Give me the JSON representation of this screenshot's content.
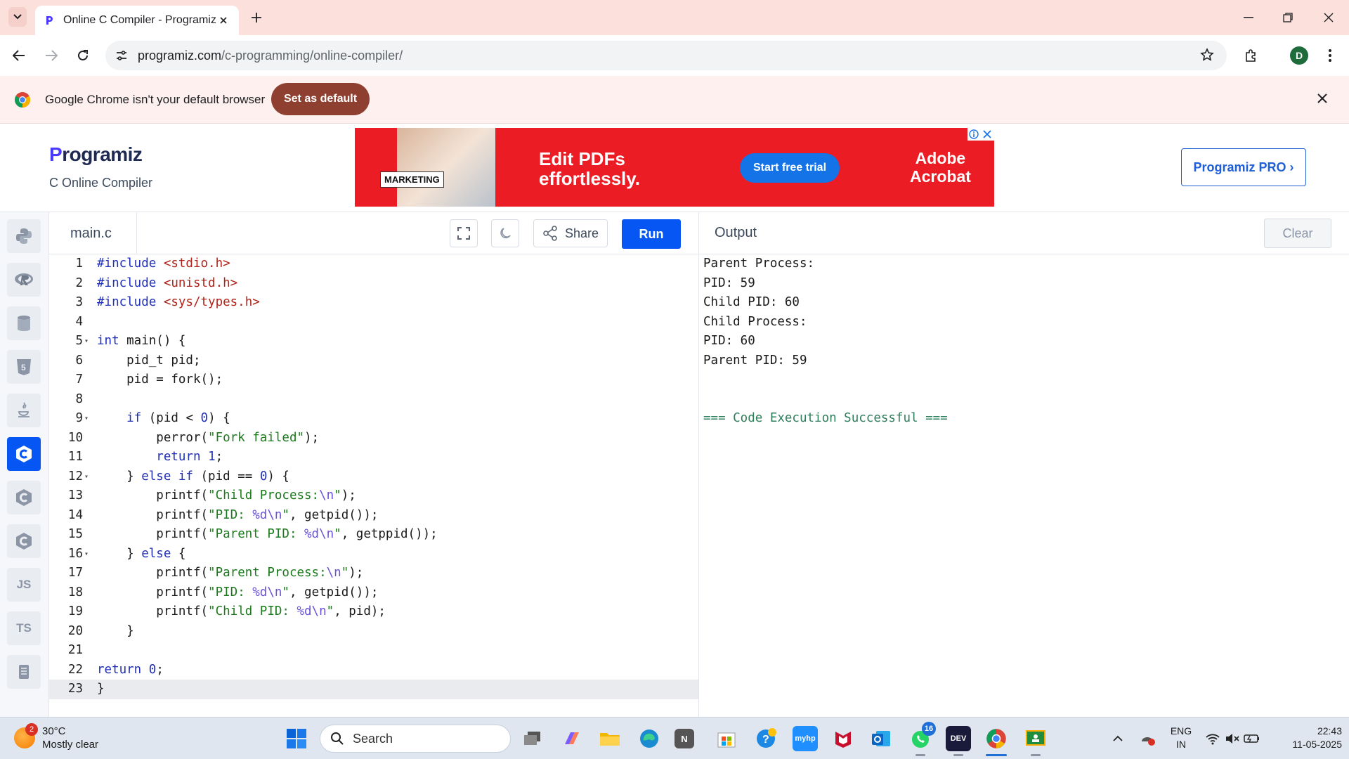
{
  "browser": {
    "tab_title": "Online C Compiler - Programiz",
    "url_host": "programiz.com",
    "url_path": "/c-programming/online-compiler/",
    "profile_initial": "D"
  },
  "infobar": {
    "message": "Google Chrome isn't your default browser",
    "button_label": "Set as default"
  },
  "site": {
    "logo_first": "P",
    "logo_rest": "rogramiz",
    "subtitle": "C Online Compiler",
    "pro_label": "Programiz PRO ›"
  },
  "ad": {
    "badge": "MARKETING",
    "headline_line1": "Edit PDFs",
    "headline_line2": "effortlessly.",
    "cta": "Start free trial",
    "brand_line1": "Adobe",
    "brand_line2": "Acrobat"
  },
  "sidebar": {
    "languages": [
      {
        "name": "python",
        "glyph": "",
        "active": false
      },
      {
        "name": "r",
        "glyph": "R",
        "active": false
      },
      {
        "name": "sql",
        "glyph": "",
        "active": false
      },
      {
        "name": "html",
        "glyph": "5",
        "active": false
      },
      {
        "name": "java",
        "glyph": "",
        "active": false
      },
      {
        "name": "c",
        "glyph": "C",
        "active": true
      },
      {
        "name": "cpp",
        "glyph": "C",
        "active": false
      },
      {
        "name": "csharp",
        "glyph": "C",
        "active": false
      },
      {
        "name": "javascript",
        "glyph": "JS",
        "active": false
      },
      {
        "name": "typescript",
        "glyph": "TS",
        "active": false
      },
      {
        "name": "go",
        "glyph": "",
        "active": false
      }
    ]
  },
  "editor": {
    "file_name": "main.c",
    "share_label": "Share",
    "run_label": "Run",
    "current_line": 23,
    "lines": [
      {
        "n": "1",
        "fold": false,
        "tokens": [
          {
            "t": "#include ",
            "c": "kw"
          },
          {
            "t": "<stdio.h>",
            "c": "inc"
          }
        ]
      },
      {
        "n": "2",
        "fold": false,
        "tokens": [
          {
            "t": "#include ",
            "c": "kw"
          },
          {
            "t": "<unistd.h>",
            "c": "inc"
          }
        ]
      },
      {
        "n": "3",
        "fold": false,
        "tokens": [
          {
            "t": "#include ",
            "c": "kw"
          },
          {
            "t": "<sys/types.h>",
            "c": "inc"
          }
        ]
      },
      {
        "n": "4",
        "fold": false,
        "tokens": []
      },
      {
        "n": "5",
        "fold": true,
        "tokens": [
          {
            "t": "int",
            "c": "kw"
          },
          {
            "t": " main() {",
            "c": ""
          }
        ]
      },
      {
        "n": "6",
        "fold": false,
        "tokens": [
          {
            "t": "    pid_t pid;",
            "c": ""
          }
        ]
      },
      {
        "n": "7",
        "fold": false,
        "tokens": [
          {
            "t": "    pid = fork();",
            "c": ""
          }
        ]
      },
      {
        "n": "8",
        "fold": false,
        "tokens": []
      },
      {
        "n": "9",
        "fold": true,
        "tokens": [
          {
            "t": "    ",
            "c": ""
          },
          {
            "t": "if",
            "c": "kw"
          },
          {
            "t": " (pid < ",
            "c": ""
          },
          {
            "t": "0",
            "c": "num"
          },
          {
            "t": ") {",
            "c": ""
          }
        ]
      },
      {
        "n": "10",
        "fold": false,
        "tokens": [
          {
            "t": "        perror(",
            "c": ""
          },
          {
            "t": "\"Fork failed\"",
            "c": "str"
          },
          {
            "t": ");",
            "c": ""
          }
        ]
      },
      {
        "n": "11",
        "fold": false,
        "tokens": [
          {
            "t": "        ",
            "c": ""
          },
          {
            "t": "return",
            "c": "kw"
          },
          {
            "t": " ",
            "c": ""
          },
          {
            "t": "1",
            "c": "num"
          },
          {
            "t": ";",
            "c": ""
          }
        ]
      },
      {
        "n": "12",
        "fold": true,
        "tokens": [
          {
            "t": "    } ",
            "c": ""
          },
          {
            "t": "else if",
            "c": "kw"
          },
          {
            "t": " (pid == ",
            "c": ""
          },
          {
            "t": "0",
            "c": "num"
          },
          {
            "t": ") {",
            "c": ""
          }
        ]
      },
      {
        "n": "13",
        "fold": false,
        "tokens": [
          {
            "t": "        printf(",
            "c": ""
          },
          {
            "t": "\"Child Process:",
            "c": "str"
          },
          {
            "t": "\\n",
            "c": "esc"
          },
          {
            "t": "\"",
            "c": "str"
          },
          {
            "t": ");",
            "c": ""
          }
        ]
      },
      {
        "n": "14",
        "fold": false,
        "tokens": [
          {
            "t": "        printf(",
            "c": ""
          },
          {
            "t": "\"PID: ",
            "c": "str"
          },
          {
            "t": "%d\\n",
            "c": "esc"
          },
          {
            "t": "\"",
            "c": "str"
          },
          {
            "t": ", getpid());",
            "c": ""
          }
        ]
      },
      {
        "n": "15",
        "fold": false,
        "tokens": [
          {
            "t": "        printf(",
            "c": ""
          },
          {
            "t": "\"Parent PID: ",
            "c": "str"
          },
          {
            "t": "%d\\n",
            "c": "esc"
          },
          {
            "t": "\"",
            "c": "str"
          },
          {
            "t": ", getppid());",
            "c": ""
          }
        ]
      },
      {
        "n": "16",
        "fold": true,
        "tokens": [
          {
            "t": "    } ",
            "c": ""
          },
          {
            "t": "else",
            "c": "kw"
          },
          {
            "t": " {",
            "c": ""
          }
        ]
      },
      {
        "n": "17",
        "fold": false,
        "tokens": [
          {
            "t": "        printf(",
            "c": ""
          },
          {
            "t": "\"Parent Process:",
            "c": "str"
          },
          {
            "t": "\\n",
            "c": "esc"
          },
          {
            "t": "\"",
            "c": "str"
          },
          {
            "t": ");",
            "c": ""
          }
        ]
      },
      {
        "n": "18",
        "fold": false,
        "tokens": [
          {
            "t": "        printf(",
            "c": ""
          },
          {
            "t": "\"PID: ",
            "c": "str"
          },
          {
            "t": "%d\\n",
            "c": "esc"
          },
          {
            "t": "\"",
            "c": "str"
          },
          {
            "t": ", getpid());",
            "c": ""
          }
        ]
      },
      {
        "n": "19",
        "fold": false,
        "tokens": [
          {
            "t": "        printf(",
            "c": ""
          },
          {
            "t": "\"Child PID: ",
            "c": "str"
          },
          {
            "t": "%d\\n",
            "c": "esc"
          },
          {
            "t": "\"",
            "c": "str"
          },
          {
            "t": ", pid);",
            "c": ""
          }
        ]
      },
      {
        "n": "20",
        "fold": false,
        "tokens": [
          {
            "t": "    }",
            "c": ""
          }
        ]
      },
      {
        "n": "21",
        "fold": false,
        "tokens": []
      },
      {
        "n": "22",
        "fold": false,
        "tokens": [
          {
            "t": "return",
            "c": "kw"
          },
          {
            "t": " ",
            "c": ""
          },
          {
            "t": "0",
            "c": "num"
          },
          {
            "t": ";",
            "c": ""
          }
        ]
      },
      {
        "n": "23",
        "fold": false,
        "tokens": [
          {
            "t": "}",
            "c": ""
          }
        ]
      }
    ]
  },
  "output": {
    "title": "Output",
    "clear_label": "Clear",
    "lines": [
      {
        "text": "Parent Process:",
        "type": "normal"
      },
      {
        "text": "PID: 59",
        "type": "normal"
      },
      {
        "text": "Child PID: 60",
        "type": "normal"
      },
      {
        "text": "Child Process:",
        "type": "normal"
      },
      {
        "text": "PID: 60",
        "type": "normal"
      },
      {
        "text": "Parent PID: 59",
        "type": "normal"
      },
      {
        "text": "",
        "type": "normal"
      },
      {
        "text": "",
        "type": "normal"
      },
      {
        "text": "=== Code Execution Successful ===",
        "type": "success"
      }
    ]
  },
  "taskbar": {
    "weather_temp": "30°C",
    "weather_desc": "Mostly clear",
    "weather_badge": "2",
    "search_placeholder": "Search",
    "whatsapp_badge": "16",
    "lang_line1": "ENG",
    "lang_line2": "IN",
    "time": "22:43",
    "date": "11-05-2025"
  },
  "colors": {
    "accent": "#0556f3",
    "success": "#2e7d5b",
    "ad_red": "#ec1c24"
  }
}
